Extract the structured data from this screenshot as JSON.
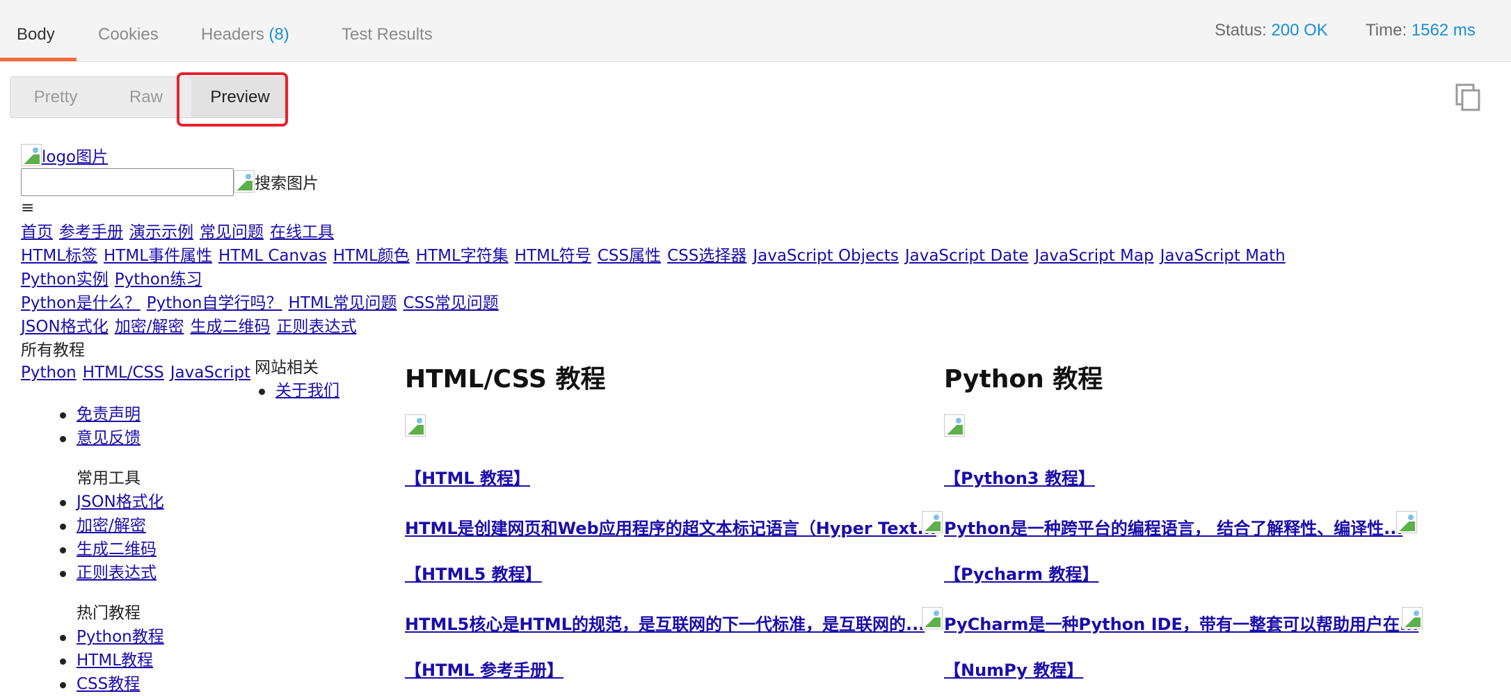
{
  "tabs": {
    "body": "Body",
    "cookies": "Cookies",
    "headers": "Headers",
    "headers_count": "(8)",
    "test_results": "Test Results"
  },
  "status": {
    "status_label": "Status:",
    "status_value": "200 OK",
    "time_label": "Time:",
    "time_value": "1562 ms"
  },
  "view_modes": {
    "pretty": "Pretty",
    "raw": "Raw",
    "preview": "Preview",
    "selected": "Preview"
  },
  "preview": {
    "logo_alt": "logo图片",
    "search_alt": "搜索图片",
    "menu_glyph": "≡",
    "nav_main": [
      "首页",
      "参考手册",
      "演示示例",
      "常见问题",
      "在线工具"
    ],
    "nav_ref": [
      "HTML标签",
      "HTML事件属性",
      "HTML Canvas",
      "HTML颜色",
      "HTML字符集",
      "HTML符号",
      "CSS属性",
      "CSS选择器",
      "JavaScript Objects",
      "JavaScript Date",
      "JavaScript Map",
      "JavaScript Math"
    ],
    "nav_demo": [
      "Python实例",
      "Python练习"
    ],
    "nav_faq": [
      "Python是什么？",
      "Python自学行吗？",
      "HTML常见问题",
      "CSS常见问题"
    ],
    "nav_tools": [
      "JSON格式化",
      "加密/解密",
      "生成二维码",
      "正则表达式"
    ],
    "all_tutorials": "所有教程",
    "tutorial_links": [
      "Python",
      "HTML/CSS",
      "JavaScript"
    ],
    "site_related": "网站相关",
    "about_us": "关于我们",
    "site_list": [
      "免责声明",
      "意见反馈"
    ],
    "common_tools_heading": "常用工具",
    "common_tools": [
      "JSON格式化",
      "加密/解密",
      "生成二维码",
      "正则表达式"
    ],
    "hot_heading": "热门教程",
    "hot_list": [
      "Python教程",
      "HTML教程",
      "CSS教程"
    ],
    "html_col": {
      "heading": "HTML/CSS 教程",
      "items": [
        "【HTML 教程】",
        "HTML是创建网页和Web应用程序的超文本标记语言（Hyper Text...",
        "【HTML5 教程】",
        "HTML5核心是HTML的规范，是互联网的下一代标准，是互联网的...",
        "【HTML 参考手册】"
      ]
    },
    "python_col": {
      "heading": "Python 教程",
      "items": [
        "【Python3 教程】",
        "Python是一种跨平台的编程语言， 结合了解释性、编译性...",
        "【Pycharm 教程】",
        "PyCharm是一种Python IDE，带有一整套可以帮助用户在...",
        "【NumPy 教程】"
      ]
    }
  }
}
